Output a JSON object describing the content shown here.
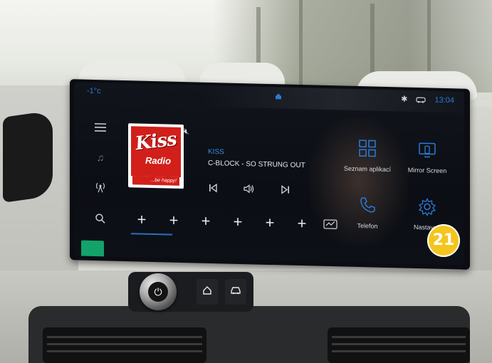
{
  "screen": {
    "status": {
      "left_text": "-1°c",
      "time": "13:04",
      "icons": [
        "bluetooth-icon",
        "car-link-icon"
      ]
    },
    "rail": {
      "items": [
        "menu-icon",
        "music-note-icon",
        "radio-signal-icon",
        "search-icon"
      ]
    },
    "media": {
      "album_art": {
        "brand": "Kiss",
        "sub": "Radio",
        "tagline": "...be happy!"
      },
      "station": "KISS",
      "track": "C-BLOCK - SO STRUNG OUT",
      "controls": [
        "previous-icon",
        "volume-icon",
        "next-icon"
      ]
    },
    "favourites": {
      "add_slots": [
        "+",
        "+",
        "+",
        "+",
        "+",
        "+"
      ]
    },
    "apps": [
      {
        "label": "Seznam aplikací",
        "icon": "grid-icon"
      },
      {
        "label": "Mirror Screen",
        "icon": "mirror-screen-icon"
      },
      {
        "label": "Telefon",
        "icon": "phone-icon"
      },
      {
        "label": "Nastaven",
        "icon": "gear-icon"
      }
    ],
    "overlay_badge": "21"
  },
  "hardware": {
    "buttons": [
      "power-icon",
      "home-icon",
      "car-icon"
    ]
  },
  "colors": {
    "accent_blue": "#2a7bd6",
    "screen_bg": "#0b0e14",
    "kiss_red": "#d21f1a",
    "badge_yellow": "#f4c51c",
    "green_chip": "#13a36a"
  }
}
